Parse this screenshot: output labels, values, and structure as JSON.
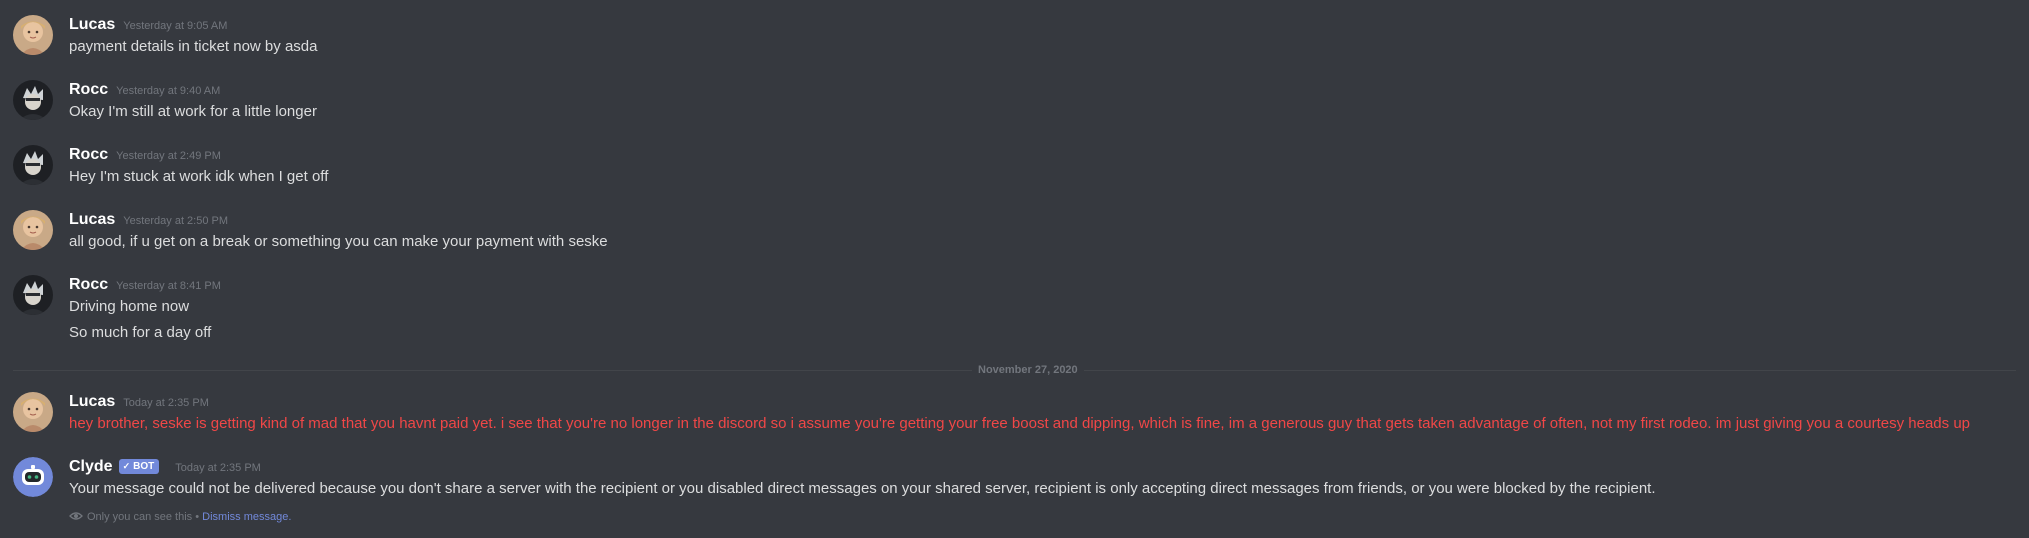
{
  "messages": [
    {
      "author": "Lucas",
      "timestamp": "Yesterday at 9:05 AM",
      "lines": [
        "payment details in ticket now by asda"
      ]
    },
    {
      "author": "Rocc",
      "timestamp": "Yesterday at 9:40 AM",
      "lines": [
        "Okay I'm still at work for a little longer"
      ]
    },
    {
      "author": "Rocc",
      "timestamp": "Yesterday at 2:49 PM",
      "lines": [
        "Hey I'm stuck at work idk when I get off"
      ]
    },
    {
      "author": "Lucas",
      "timestamp": "Yesterday at 2:50 PM",
      "lines": [
        "all good, if u get on a break or something you can make your payment with seske"
      ]
    },
    {
      "author": "Rocc",
      "timestamp": "Yesterday at 8:41 PM",
      "lines": [
        "Driving home now",
        "So much for a day off"
      ]
    },
    {
      "author": "Lucas",
      "timestamp": "Today at 2:35 PM",
      "lines": [
        "hey brother, seske is getting kind of mad that you havnt paid yet. i see that you're no longer in the discord so i assume you're getting your free boost and dipping, which is fine, im a generous guy that gets taken advantage of often, not my first rodeo. im just giving you a courtesy heads up"
      ]
    },
    {
      "author": "Clyde",
      "bot_tag": "BOT",
      "bot_check": "✓",
      "timestamp": "Today at 2:35 PM",
      "lines": [
        "Your message could not be delivered because you don't share a server with the recipient or you disabled direct messages on your shared server, recipient is only accepting direct messages from friends, or you were blocked by the recipient."
      ]
    }
  ],
  "date_divider": "November 27, 2020",
  "ephemeral": {
    "notice": "Only you can see this",
    "separator": "•",
    "dismiss": "Dismiss message."
  },
  "colors": {
    "background": "#36393f",
    "username": "#ffffff",
    "text": "#dcddde",
    "timestamp": "#72767d",
    "failed_text": "#f04747",
    "bot_tag": "#7289da",
    "link": "#7289da"
  },
  "icons": {
    "lucas_avatar": "user-avatar-photo",
    "rocc_avatar": "user-avatar-photo",
    "clyde_avatar": "clyde-bot-avatar",
    "eye": "eye-icon"
  }
}
